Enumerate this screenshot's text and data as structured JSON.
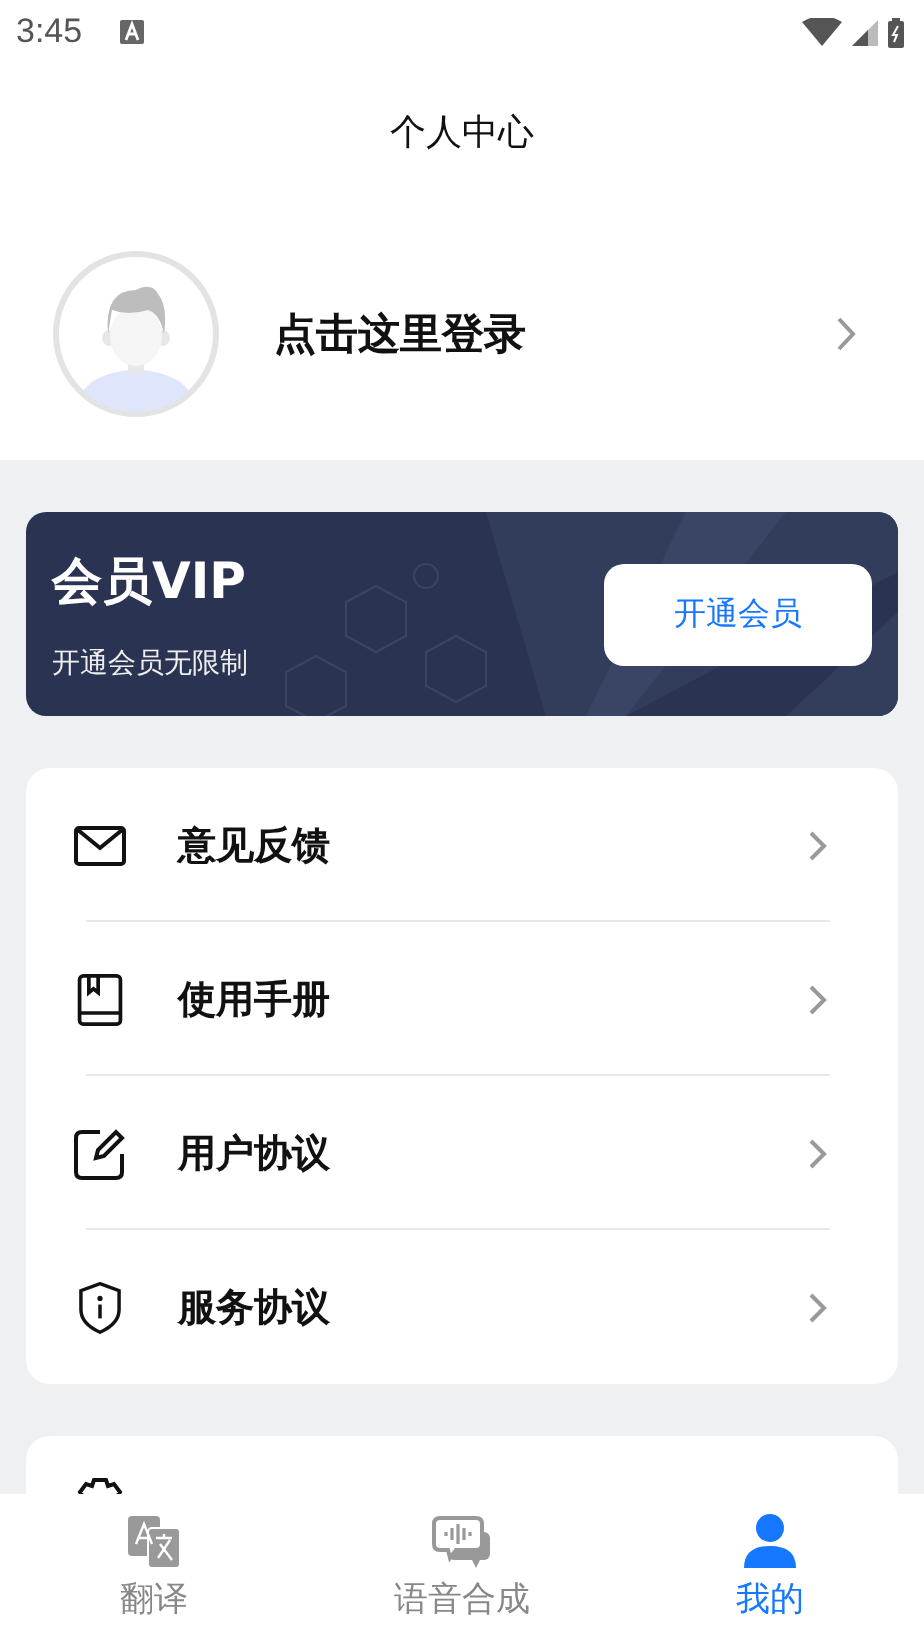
{
  "status_bar": {
    "time": "3:45"
  },
  "header": {
    "title": "个人中心"
  },
  "profile": {
    "login_text": "点击这里登录"
  },
  "vip": {
    "title": "会员VIP",
    "subtitle": "开通会员无限制",
    "button": "开通会员"
  },
  "menu": [
    {
      "kind": "mail",
      "label": "意见反馈"
    },
    {
      "kind": "book",
      "label": "使用手册"
    },
    {
      "kind": "edit",
      "label": "用户协议"
    },
    {
      "kind": "shield",
      "label": "服务协议"
    }
  ],
  "more_menu": [
    {
      "kind": "gear"
    }
  ],
  "tabs": [
    {
      "kind": "translate",
      "label": "翻译",
      "selected": false
    },
    {
      "kind": "voice",
      "label": "语音合成",
      "selected": false
    },
    {
      "kind": "user",
      "label": "我的",
      "selected": true
    }
  ]
}
